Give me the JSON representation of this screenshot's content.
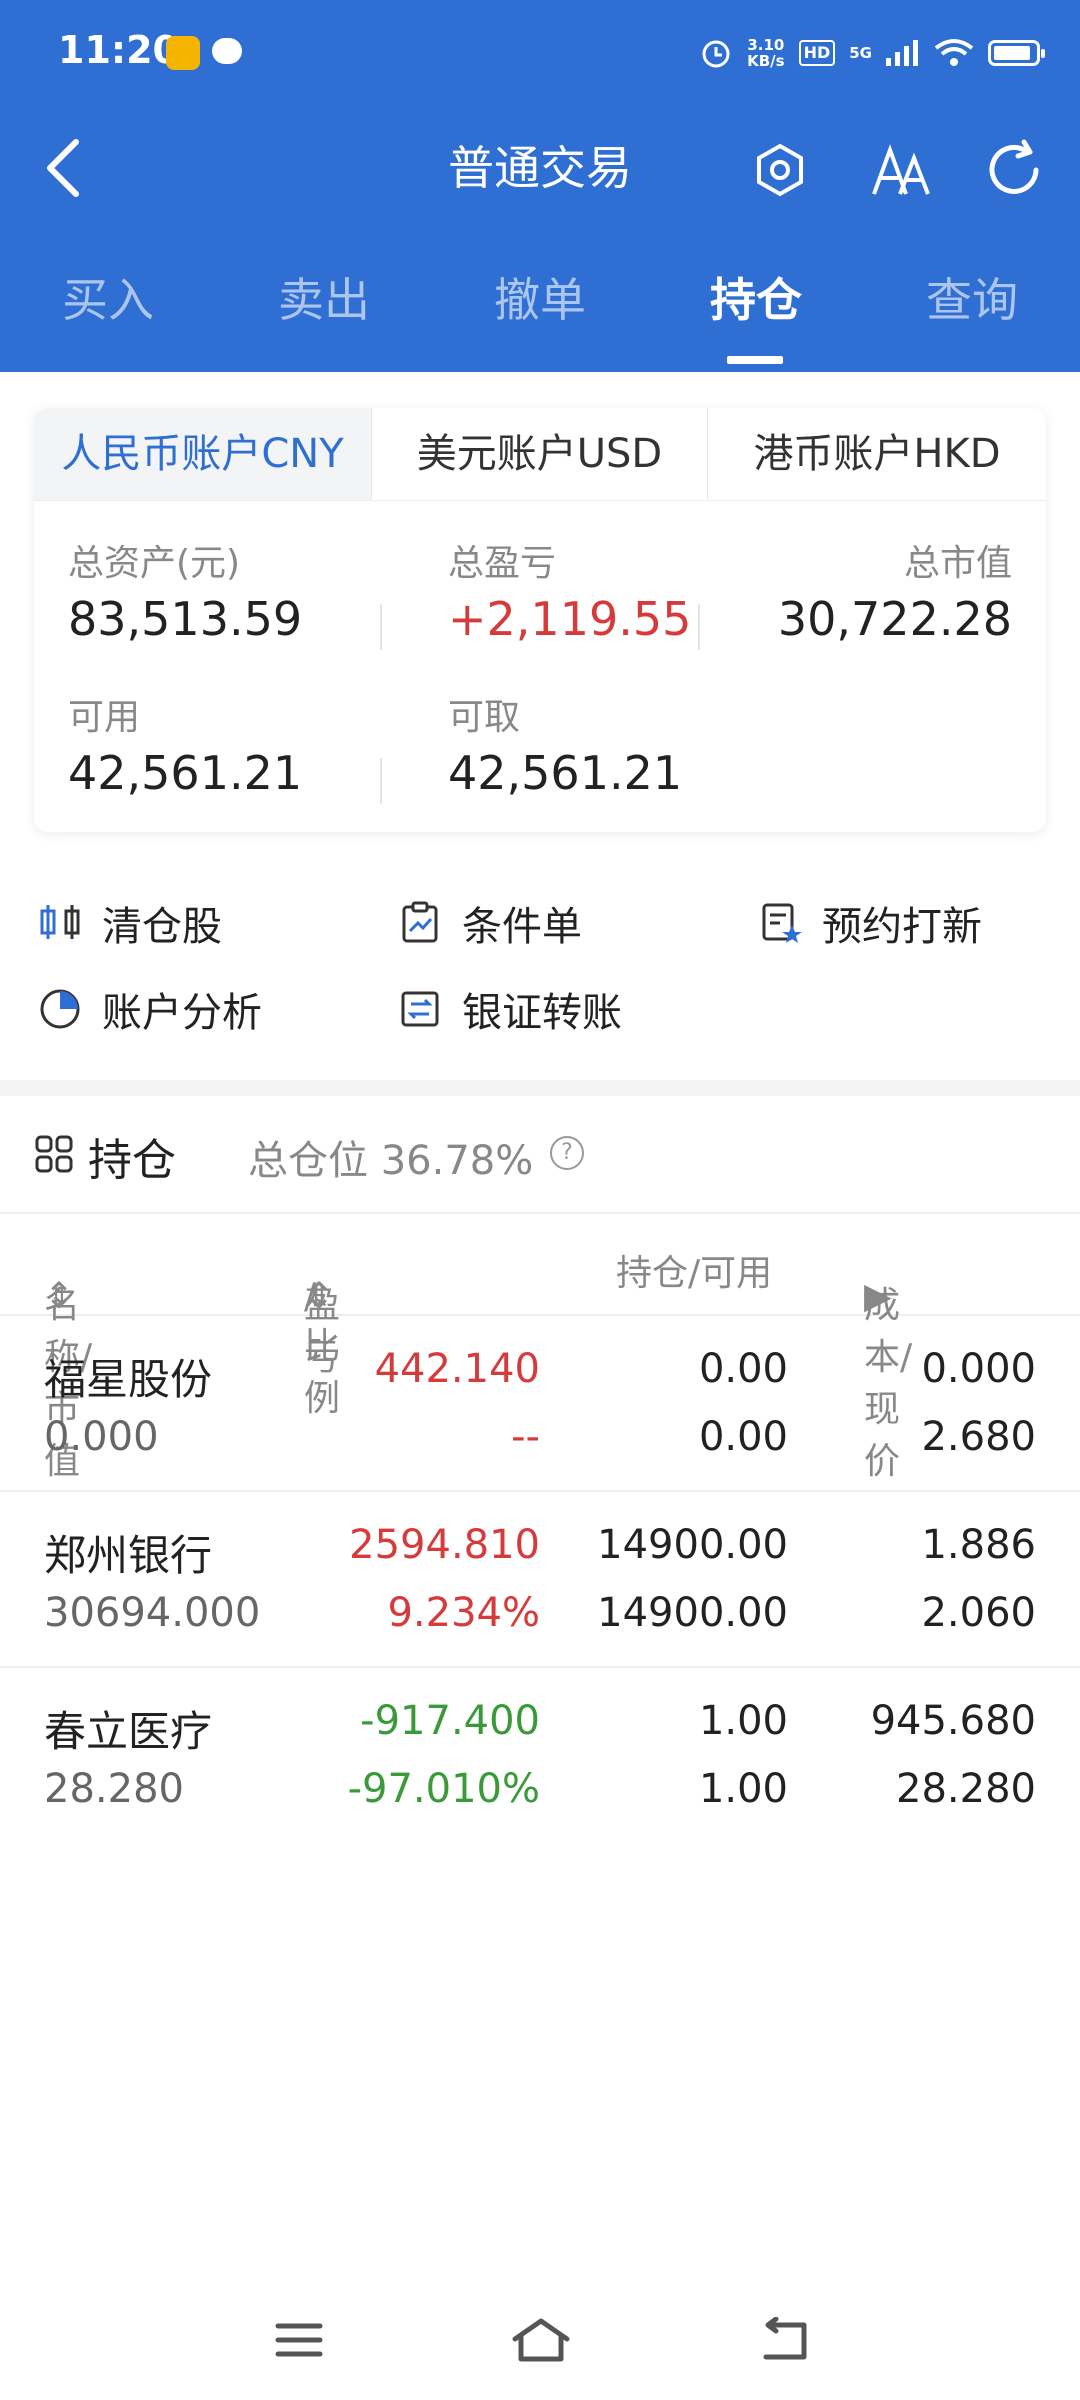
{
  "status_bar": {
    "time": "11:20",
    "net_speed": "3.10",
    "net_unit": "KB/s",
    "hd": "HD",
    "signal": "5G"
  },
  "nav": {
    "title": "普通交易",
    "icons": [
      "back-icon",
      "settings-icon",
      "font-size-icon",
      "refresh-icon"
    ]
  },
  "tabs": [
    {
      "label": "买入"
    },
    {
      "label": "卖出"
    },
    {
      "label": "撤单"
    },
    {
      "label": "持仓",
      "active": true
    },
    {
      "label": "查询"
    }
  ],
  "account": {
    "tabs": [
      "人民币账户CNY",
      "美元账户USD",
      "港币账户HKD"
    ],
    "total_assets_label": "总资产(元)",
    "total_assets": "83,513.59",
    "total_pnl_label": "总盈亏",
    "total_pnl": "+2,119.55",
    "market_value_label": "总市值",
    "market_value": "30,722.28",
    "available_label": "可用",
    "available": "42,561.21",
    "withdrawable_label": "可取",
    "withdrawable": "42,561.21"
  },
  "quick_actions": [
    {
      "label": "清仓股",
      "icon": "clear-position-icon"
    },
    {
      "label": "条件单",
      "icon": "conditional-order-icon"
    },
    {
      "label": "预约打新",
      "icon": "ipo-reservation-icon"
    },
    {
      "label": "账户分析",
      "icon": "pie-chart-icon"
    },
    {
      "label": "银证转账",
      "icon": "transfer-icon"
    }
  ],
  "positions": {
    "title": "持仓",
    "ratio_label": "总仓位 36.78%",
    "columns": [
      "名称/市值",
      "盈亏",
      "/比例",
      "持仓/可用",
      "成本/现价"
    ],
    "rows": [
      {
        "name": "福星股份",
        "mv": "0.000",
        "pnl": "442.140",
        "ratio": "--",
        "hold": "0.00",
        "avail": "0.00",
        "cost": "0.000",
        "price": "2.680",
        "pnl_color": "#d63a3a",
        "ratio_color": "#d63a3a"
      },
      {
        "name": "郑州银行",
        "mv": "30694.000",
        "pnl": "2594.810",
        "ratio": "9.234%",
        "hold": "14900.00",
        "avail": "14900.00",
        "cost": "1.886",
        "price": "2.060",
        "pnl_color": "#d63a3a",
        "ratio_color": "#d63a3a"
      },
      {
        "name": "春立医疗",
        "mv": "28.280",
        "pnl": "-917.400",
        "ratio": "-97.010%",
        "hold": "1.00",
        "avail": "1.00",
        "cost": "945.680",
        "price": "28.280",
        "pnl_color": "#3a9a3a",
        "ratio_color": "#3a9a3a"
      }
    ]
  },
  "colors": {
    "brand": "#2f6fd3",
    "up": "#d63a3a",
    "down": "#3a9a3a"
  }
}
